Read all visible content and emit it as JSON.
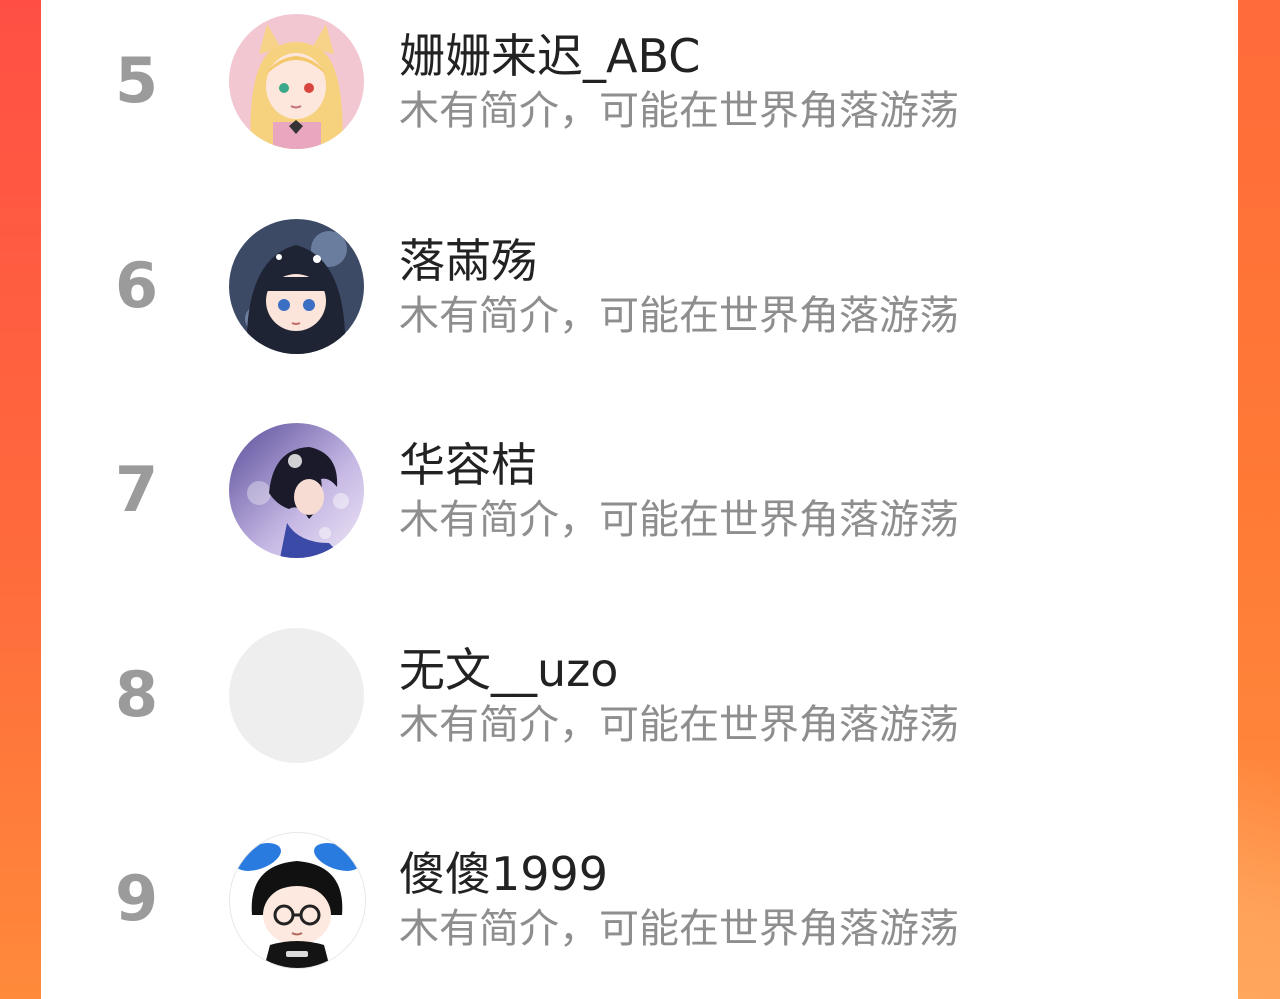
{
  "ranking": {
    "items": [
      {
        "rank": "5",
        "name": "姗姗来迟_ABC",
        "bio": "木有简介，可能在世界角落游荡",
        "avatar": "anime-girl-fox-ears-avatar"
      },
      {
        "rank": "6",
        "name": "落㒼殇",
        "bio": "木有简介，可能在世界角落游荡",
        "avatar": "anime-girl-dark-hair-avatar"
      },
      {
        "rank": "7",
        "name": "华容桔",
        "bio": "木有简介，可能在世界角落游荡",
        "avatar": "illustrated-girl-bubbles-avatar"
      },
      {
        "rank": "8",
        "name": "无文__uzo",
        "bio": "木有简介，可能在世界角落游荡",
        "avatar": "empty-placeholder-avatar"
      },
      {
        "rank": "9",
        "name": "傻傻1999",
        "bio": "木有简介，可能在世界角落游荡",
        "avatar": "cartoon-boy-bunny-ears-avatar"
      }
    ]
  },
  "colors": {
    "rank_text": "#9b9b9b",
    "name_text": "#222222",
    "bio_text": "#8e8e8e",
    "panel_bg": "#ffffff",
    "side_gradient_top": "#ff4f45",
    "side_gradient_bottom": "#ff8a3a"
  }
}
